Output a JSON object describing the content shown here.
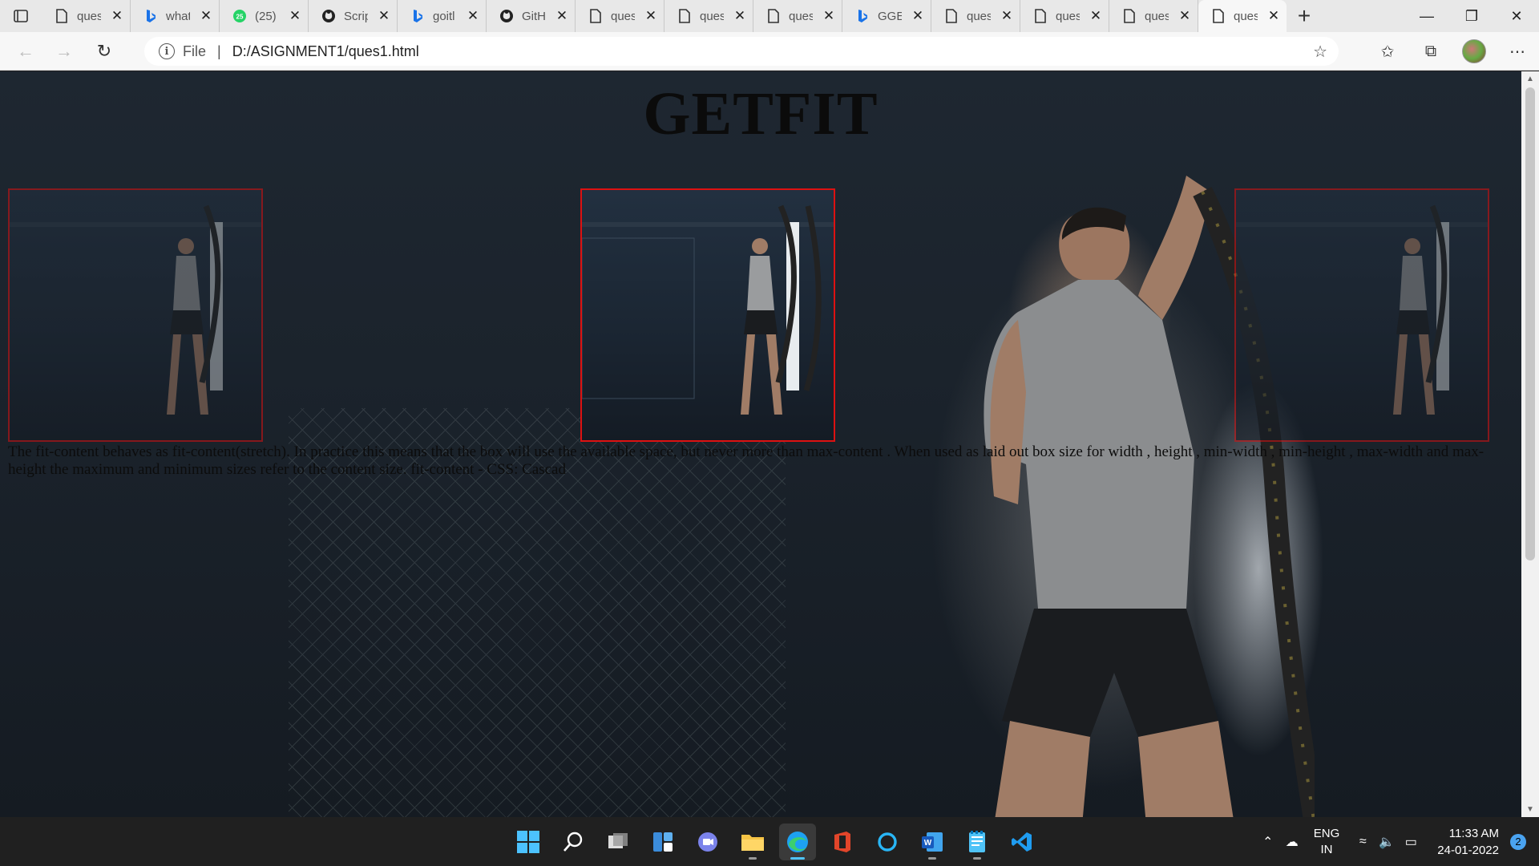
{
  "browser": {
    "tabs": [
      {
        "label": "ques",
        "icon": "page-icon"
      },
      {
        "label": "what",
        "icon": "bing-icon"
      },
      {
        "label": "(25) ",
        "icon": "whatsapp-icon"
      },
      {
        "label": "Scrip",
        "icon": "github-icon"
      },
      {
        "label": "goitl",
        "icon": "bing-icon"
      },
      {
        "label": "GitH",
        "icon": "github-icon"
      },
      {
        "label": "ques",
        "icon": "page-icon"
      },
      {
        "label": "ques",
        "icon": "page-icon"
      },
      {
        "label": "ques",
        "icon": "page-icon"
      },
      {
        "label": "GGE",
        "icon": "bing-icon"
      },
      {
        "label": "ques",
        "icon": "page-icon"
      },
      {
        "label": "ques",
        "icon": "page-icon"
      },
      {
        "label": "ques",
        "icon": "page-icon"
      },
      {
        "label": "ques",
        "icon": "page-icon",
        "active": true
      }
    ],
    "address": {
      "scheme": "File",
      "url": "D:/ASIGNMENT1/ques1.html"
    }
  },
  "page": {
    "title": "GETFIT",
    "paragraph": "The fit-content behaves as fit-content(stretch). In practice this means that the box will use the available space, but never more than max-content . When used as laid out box size for width , height , min-width , min-height , max-width and max-height the maximum and minimum sizes refer to the content size. fit-content - CSS: Cascad",
    "frame_color": "#dd1111"
  },
  "taskbar": {
    "apps": [
      "windows-start-icon",
      "search-icon",
      "task-view-icon",
      "widgets-icon",
      "teams-chat-icon",
      "file-explorer-icon",
      "edge-icon",
      "office-icon",
      "cortana-icon",
      "word-icon",
      "notepad-icon",
      "vscode-icon"
    ],
    "language": {
      "line1": "ENG",
      "line2": "IN"
    },
    "time": "11:33 AM",
    "date": "24-01-2022",
    "notifications": "2"
  }
}
